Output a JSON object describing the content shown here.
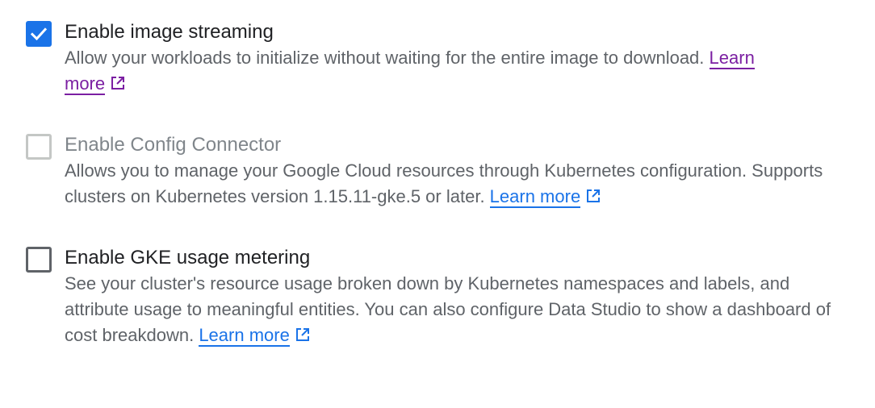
{
  "colors": {
    "accent": "#1a73e8",
    "visited_link": "#7b1fa2",
    "text_primary": "#202124",
    "text_secondary": "#5f6368",
    "text_disabled": "#80868b"
  },
  "options": [
    {
      "title": "Enable image streaming",
      "checked": true,
      "disabled": false,
      "description": "Allow your workloads to initialize without waiting for the entire image to download. ",
      "link_label_a": "Learn",
      "link_label_b": "more",
      "link_icon": "external-link-icon"
    },
    {
      "title": "Enable Config Connector",
      "checked": false,
      "disabled": true,
      "description": "Allows you to manage your Google Cloud resources through Kubernetes configuration. Supports clusters on Kubernetes version 1.15.11-gke.5 or later. ",
      "link_label": "Learn more",
      "link_icon": "external-link-icon"
    },
    {
      "title": "Enable GKE usage metering",
      "checked": false,
      "disabled": false,
      "description": "See your cluster's resource usage broken down by Kubernetes namespaces and labels, and attribute usage to meaningful entities. You can also configure Data Studio to show a dashboard of cost breakdown. ",
      "link_label": "Learn more",
      "link_icon": "external-link-icon"
    }
  ]
}
